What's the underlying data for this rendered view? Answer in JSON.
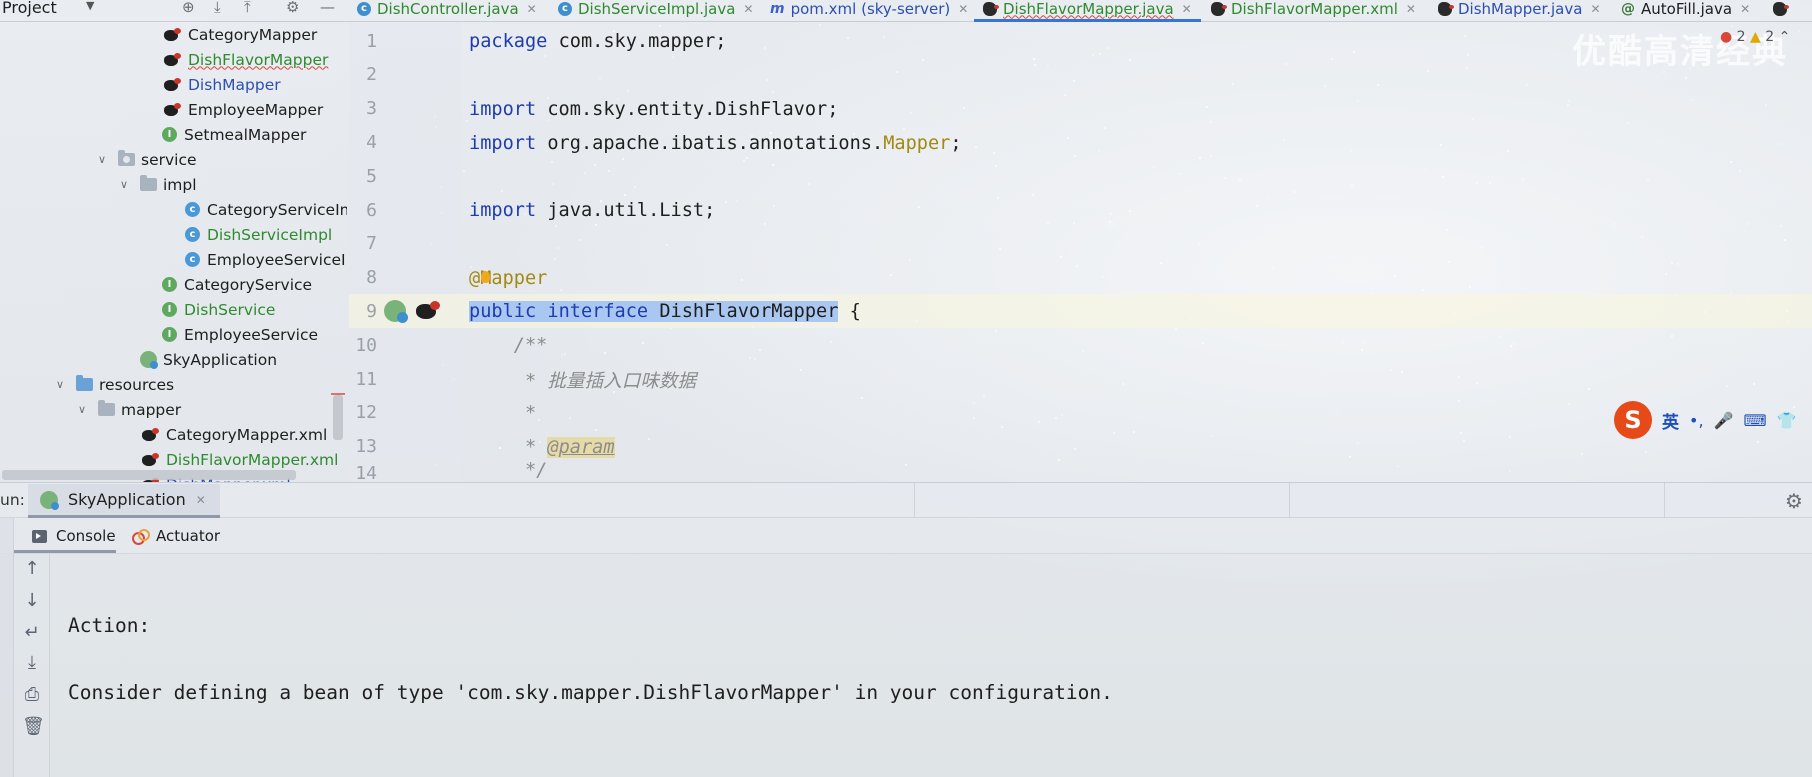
{
  "window": {
    "title": "Project"
  },
  "tabs": [
    {
      "label": "DishController.java",
      "icon": "class-icon",
      "color": "#2f8a2f"
    },
    {
      "label": "DishServiceImpl.java",
      "icon": "class-icon",
      "color": "#2f8a2f"
    },
    {
      "label": "pom.xml (sky-server)",
      "icon": "maven-icon",
      "color": "#2c4fb0"
    },
    {
      "label": "DishFlavorMapper.java",
      "icon": "mybatis-icon",
      "color": "#2f8a2f",
      "active": true
    },
    {
      "label": "DishFlavorMapper.xml",
      "icon": "mybatis-icon",
      "color": "#2f8a2f"
    },
    {
      "label": "DishMapper.java",
      "icon": "mybatis-icon",
      "color": "#2c4fb0"
    },
    {
      "label": "AutoFill.java",
      "icon": "annotation-icon",
      "color": "#1e1e1e"
    }
  ],
  "inspections": {
    "errors": "2",
    "warnings": "2"
  },
  "tree": [
    {
      "label": "CategoryMapper",
      "icon": "mybatis-icon",
      "color": "#1e1e1e"
    },
    {
      "label": "DishFlavorMapper",
      "icon": "mybatis-icon",
      "color": "#2f8a2f"
    },
    {
      "label": "DishMapper",
      "icon": "mybatis-icon",
      "color": "#2c4fb0"
    },
    {
      "label": "EmployeeMapper",
      "icon": "mybatis-icon",
      "color": "#1e1e1e"
    },
    {
      "label": "SetmealMapper",
      "icon": "interface-icon",
      "color": "#1e1e1e"
    },
    {
      "label": "service",
      "icon": "folder-icon",
      "color": "#1e1e1e"
    },
    {
      "label": "impl",
      "icon": "folder-icon",
      "color": "#1e1e1e"
    },
    {
      "label": "CategoryServiceIm",
      "icon": "class-icon",
      "color": "#1e1e1e"
    },
    {
      "label": "DishServiceImpl",
      "icon": "class-icon",
      "color": "#2f8a2f"
    },
    {
      "label": "EmployeeServiceIn",
      "icon": "class-icon",
      "color": "#1e1e1e"
    },
    {
      "label": "CategoryService",
      "icon": "interface-icon",
      "color": "#1e1e1e"
    },
    {
      "label": "DishService",
      "icon": "interface-icon",
      "color": "#2f8a2f"
    },
    {
      "label": "EmployeeService",
      "icon": "interface-icon",
      "color": "#1e1e1e"
    },
    {
      "label": "SkyApplication",
      "icon": "spring-boot-icon",
      "color": "#1e1e1e"
    },
    {
      "label": "resources",
      "icon": "resources-folder-icon",
      "color": "#1e1e1e"
    },
    {
      "label": "mapper",
      "icon": "folder-icon",
      "color": "#1e1e1e"
    },
    {
      "label": "CategoryMapper.xml",
      "icon": "mybatis-icon",
      "color": "#1e1e1e"
    },
    {
      "label": "DishFlavorMapper.xml",
      "icon": "mybatis-icon",
      "color": "#2f8a2f"
    },
    {
      "label": "DishMapper.xml",
      "icon": "mybatis-icon",
      "color": "#2c4fb0"
    }
  ],
  "editor": {
    "line_numbers": [
      "1",
      "2",
      "3",
      "4",
      "5",
      "6",
      "7",
      "8",
      "9",
      "10",
      "11",
      "12",
      "13",
      "14"
    ],
    "code": {
      "l1_kw": "package",
      "l1_rest": " com.sky.mapper;",
      "l3_kw": "import",
      "l3_rest": " com.sky.entity.DishFlavor;",
      "l4_kw": "import",
      "l4_rest": " org.apache.ibatis.annotations.",
      "l4_ann": "Mapper",
      "l4_end": ";",
      "l6_kw": "import",
      "l6_rest": " java.util.List;",
      "l8_ann": "@Mapper",
      "l9_kw1": "public",
      "l9_kw2": "interface",
      "l9_name": "DishFlavorMapper",
      "l9_end": " {",
      "l10": "    /**",
      "l11": "     * 批量插入口味数据",
      "l12": "     *",
      "l13_pre": "     * ",
      "l13_tag": "@param",
      "l14": "     */"
    }
  },
  "watermark": "优酷高清经典",
  "ime": {
    "lang": "英",
    "punct": "•,",
    "mic": "🎤",
    "keyboard": "⌨",
    "skin": "👕"
  },
  "run": {
    "label": "un:",
    "tab": "SkyApplication",
    "subtabs": {
      "console": "Console",
      "actuator": "Actuator"
    }
  },
  "console": {
    "lines": [
      "Action:",
      "Consider defining a bean of type 'com.sky.mapper.DishFlavorMapper' in your configuration."
    ]
  }
}
